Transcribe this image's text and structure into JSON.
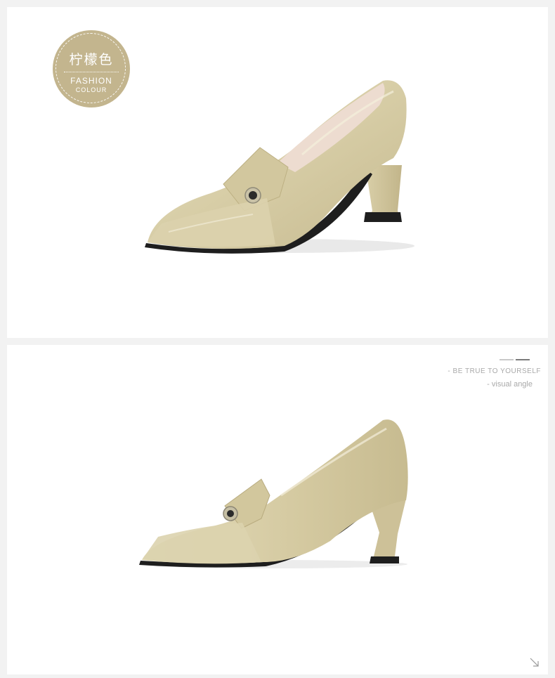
{
  "badge": {
    "cn_label": "柠檬色",
    "en_label": "FASHION",
    "en_sub": "COLOUR"
  },
  "tagline": {
    "line1": "- BE TRUE TO YOURSELF",
    "line2": "- visual angle"
  },
  "colors": {
    "page_bg": "#f2f2f2",
    "panel_bg": "#ffffff",
    "badge_bg": "#c3b58e",
    "shoe_leather": "#d9d0ab",
    "sole_dark": "#1e1e1e",
    "text_muted": "#a9a9a9"
  },
  "icons": {
    "corner": "arrow-down-right-icon"
  }
}
